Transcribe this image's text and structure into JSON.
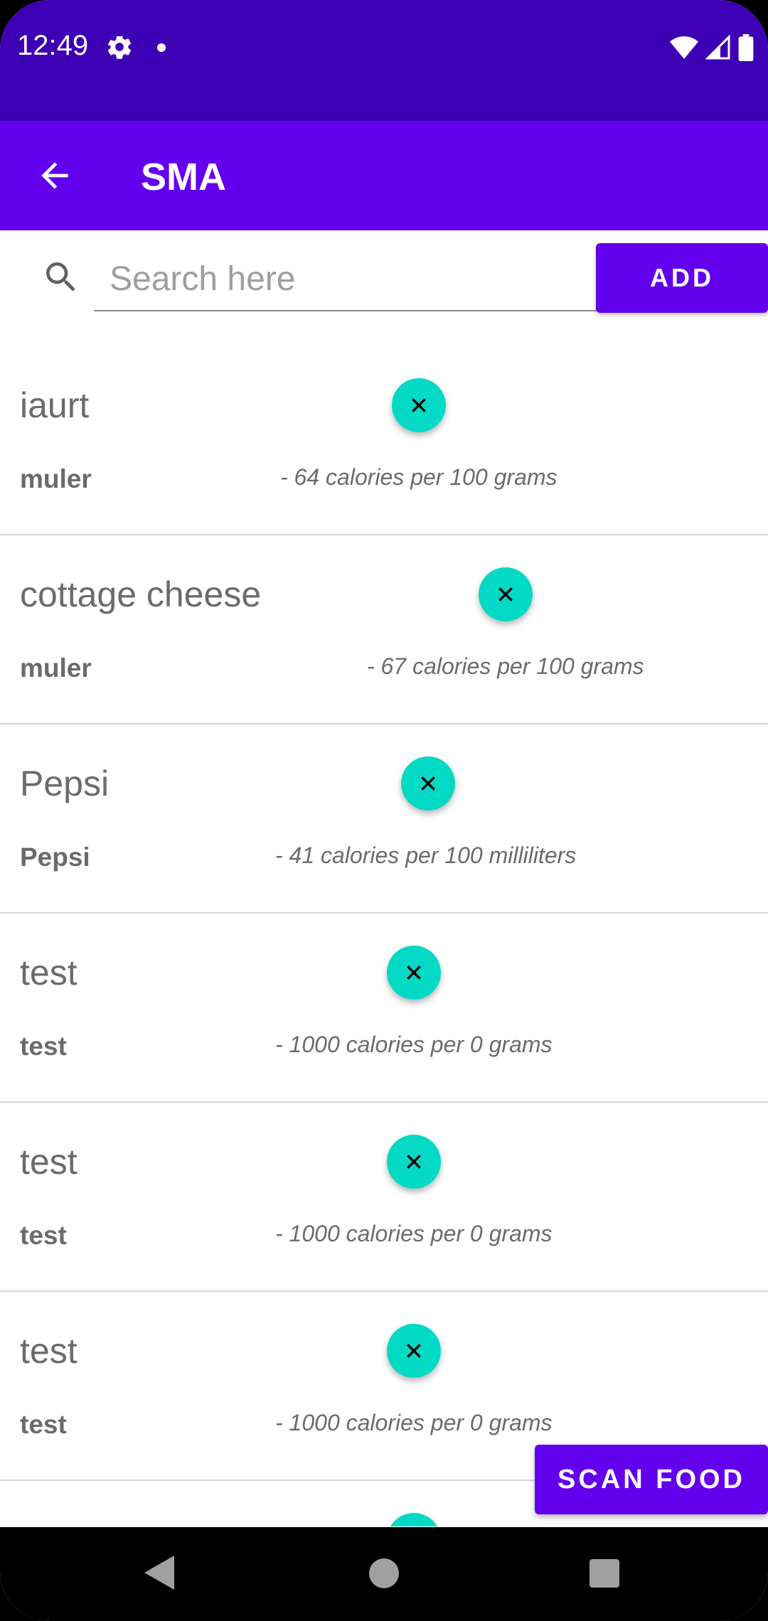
{
  "status_bar": {
    "time": "12:49",
    "icons": [
      "gear-icon",
      "notification-dot-icon",
      "wifi-icon",
      "signal-icon",
      "battery-icon"
    ]
  },
  "app_bar": {
    "title": "SMA",
    "back_icon": "arrow-back-icon"
  },
  "search": {
    "placeholder": "Search here",
    "value": "",
    "icon": "search-icon"
  },
  "add_button": {
    "label": "ADD"
  },
  "food_items": [
    {
      "name": "iaurt",
      "brand": "muler",
      "calories": "- 64 calories per 100 grams"
    },
    {
      "name": "cottage cheese",
      "brand": "muler",
      "calories": "- 67 calories per 100 grams"
    },
    {
      "name": "Pepsi",
      "brand": "Pepsi",
      "calories": "- 41 calories per 100 milliliters"
    },
    {
      "name": "test",
      "brand": "test",
      "calories": "- 1000 calories per 0 grams"
    },
    {
      "name": "test",
      "brand": "test",
      "calories": "- 1000 calories per 0 grams"
    },
    {
      "name": "test",
      "brand": "test",
      "calories": "- 1000 calories per 0 grams"
    }
  ],
  "delete_icon": "close-icon",
  "scan_button": {
    "label": "SCAN FOOD"
  },
  "nav_bar": {
    "icons": [
      "nav-back-icon",
      "nav-home-icon",
      "nav-recents-icon"
    ]
  },
  "colors": {
    "status_bar": "#3d00b5",
    "primary": "#6200ee",
    "accent": "#03dac5",
    "text": "#6b6b6b"
  }
}
